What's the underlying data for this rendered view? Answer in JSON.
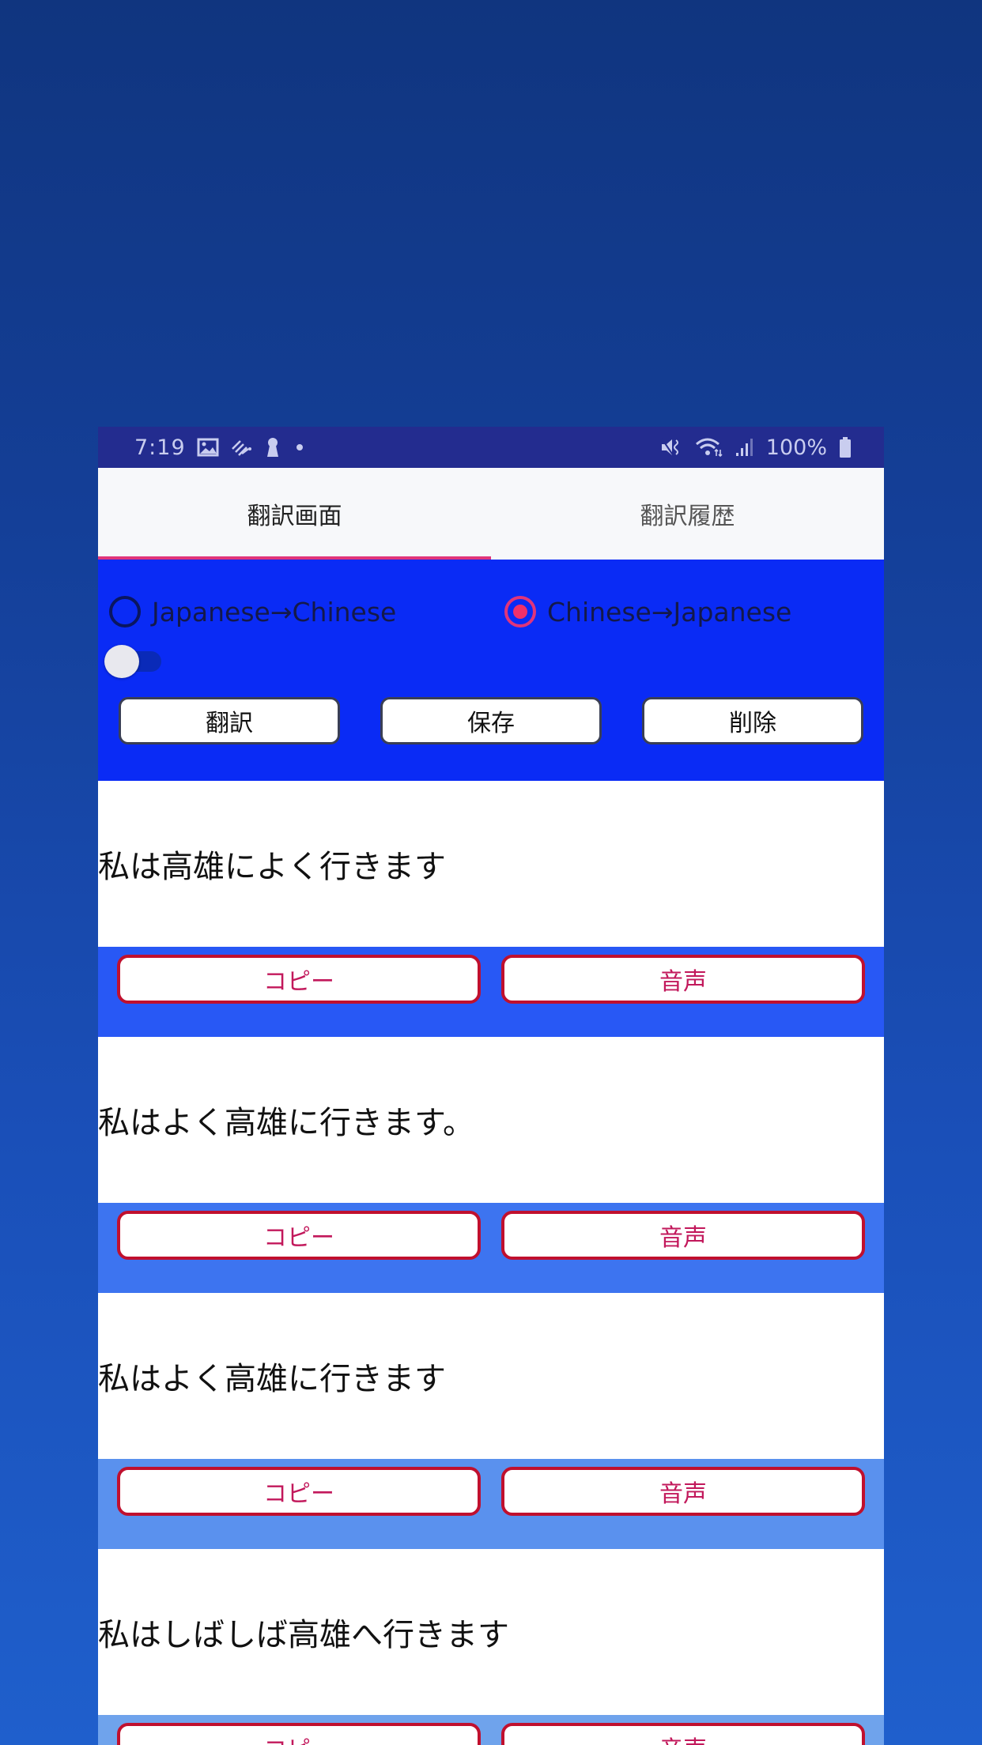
{
  "status_bar": {
    "time": "7:19",
    "left_icons": [
      "gallery-icon",
      "zebra-app-icon",
      "keyhole-icon",
      "dot-icon"
    ],
    "right_icons": [
      "mute-vibrate-icon",
      "wifi-icon",
      "signal-icon"
    ],
    "battery": "100%"
  },
  "tabs": [
    {
      "label": "翻訳画面",
      "active": true
    },
    {
      "label": "翻訳履歴",
      "active": false
    }
  ],
  "controls": {
    "radio_options": [
      {
        "label": "Japanese→Chinese",
        "checked": false
      },
      {
        "label": "Chinese→Japanese",
        "checked": true
      }
    ],
    "switch_on": false,
    "buttons": {
      "translate": "翻訳",
      "save": "保存",
      "delete": "削除"
    }
  },
  "results": [
    {
      "text": "私は高雄によく行きます",
      "copy_label": "コピー",
      "speak_label": "音声"
    },
    {
      "text": "私はよく高雄に行きます。",
      "copy_label": "コピー",
      "speak_label": "音声"
    },
    {
      "text": "私はよく高雄に行きます",
      "copy_label": "コピー",
      "speak_label": "音声"
    },
    {
      "text": "私はしばしば高雄へ行きます",
      "copy_label": "コピー",
      "speak_label": "音声"
    }
  ],
  "colors": {
    "status_bar": "#232C8F",
    "tab_indicator": "#E0357A",
    "control_panel": "#0A2BF5",
    "result_button_border": "#C0102E",
    "result_button_text": "#C2185B"
  }
}
